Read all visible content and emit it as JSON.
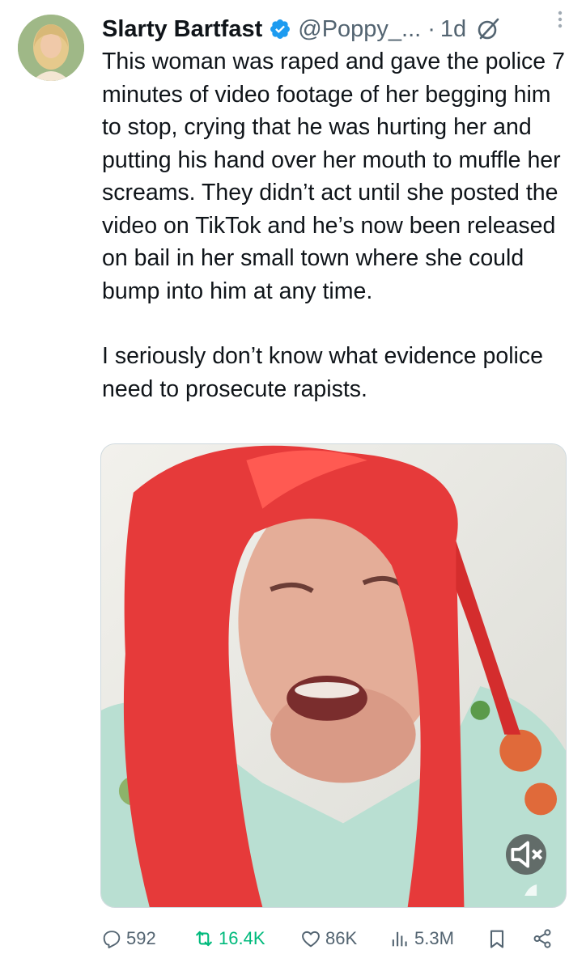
{
  "author": {
    "display_name": "Slarty Bartfast",
    "handle": "@Poppy_...",
    "separator": "·",
    "time": "1d",
    "verified": true
  },
  "tweet": {
    "paragraphs": [
      "This woman was raped and gave the police 7 minutes of video footage of her begging him to stop, crying that he was hurting her and putting his hand over her mouth to muffle her screams. They didn’t act until she posted the video on TikTok and he’s now been released on bail in her small town where she could bump into him at any time.",
      "I seriously don’t know what evidence police need to prosecute rapists."
    ]
  },
  "media": {
    "type": "video",
    "description_icons": [
      "mute-icon",
      "tiktok-icon"
    ]
  },
  "stats": {
    "replies": "592",
    "retweets": "16.4K",
    "likes": "86K",
    "views": "5.3M"
  },
  "colors": {
    "verified": "#1d9bf0",
    "retweet_active": "#00ba7c",
    "muted_text": "#536471",
    "text": "#0f1419"
  },
  "icons": [
    "verified-badge-icon",
    "grok-icon",
    "more-icon",
    "reply-icon",
    "retweet-icon",
    "like-icon",
    "views-icon",
    "bookmark-icon",
    "share-icon"
  ]
}
